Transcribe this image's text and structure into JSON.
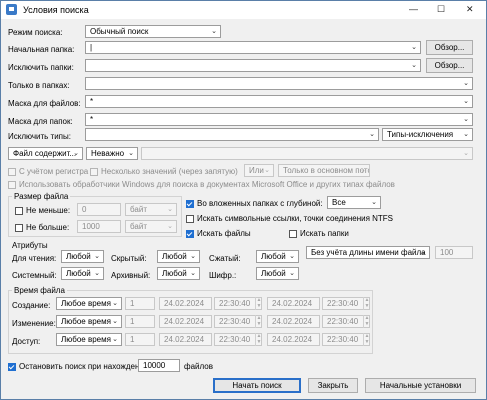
{
  "window": {
    "title": "Условия поиска",
    "minimize": "—",
    "maximize": "☐",
    "close": "✕"
  },
  "mode": {
    "label": "Режим поиска:",
    "value": "Обычный поиск"
  },
  "start_folder": {
    "label": "Начальная папка:",
    "value": "",
    "browse": "Обзор..."
  },
  "exclude_folders": {
    "label": "Исключить папки:",
    "value": "",
    "browse": "Обзор..."
  },
  "only_folders": {
    "label": "Только в папках:",
    "value": ""
  },
  "file_mask": {
    "label": "Маска для файлов:",
    "value": "*"
  },
  "folder_mask": {
    "label": "Маска для папок:",
    "value": "*"
  },
  "exclude_types": {
    "label": "Исключить типы:",
    "value": "",
    "type_select": "Типы-исключения"
  },
  "content": {
    "mode": "Файл содержит...",
    "match": "Неважно",
    "value": ""
  },
  "content_opts": {
    "case": "С учётом регистра",
    "multi": "Несколько значений (через запятую)",
    "or": "Или",
    "stream": "Только в основном потс",
    "office": "Использовать обработчики Windows для поиска в документах Microsoft Office и других типах файлов"
  },
  "size_group": {
    "title": "Размер файла",
    "not_less": "Не меньше:",
    "not_less_val": "0",
    "not_less_unit": "байт",
    "not_more": "Не больше:",
    "not_more_val": "1000",
    "not_more_unit": "байт"
  },
  "subfolders": {
    "label": "Во вложенных папках с глубиной:",
    "value": "Все",
    "checked": true
  },
  "symlinks": {
    "label": "Искать символьные ссылки, точки соединения NTFS",
    "checked": false
  },
  "search_files": {
    "label": "Искать файлы",
    "checked": true
  },
  "search_folders": {
    "label": "Искать папки",
    "checked": false
  },
  "attrs": {
    "title": "Атрибуты",
    "read": "Для чтения:",
    "read_val": "Любой",
    "hidden": "Скрытый:",
    "hidden_val": "Любой",
    "compressed": "Сжатый:",
    "compressed_val": "Любой",
    "system": "Системный:",
    "system_val": "Любой",
    "archive": "Архивный:",
    "archive_val": "Любой",
    "encrypted": "Шифр.:",
    "encrypted_val": "Любой"
  },
  "name_len": {
    "value": "Без учёта длины имени файла",
    "num": "100"
  },
  "time_group": {
    "title": "Время файла",
    "rows": [
      {
        "label": "Создание:",
        "mode": "Любое время",
        "n": "1",
        "d1": "24.02.2024",
        "t1": "22:30:40",
        "d2": "24.02.2024",
        "t2": "22:30:40"
      },
      {
        "label": "Изменение:",
        "mode": "Любое время",
        "n": "1",
        "d1": "24.02.2024",
        "t1": "22:30:40",
        "d2": "24.02.2024",
        "t2": "22:30:40"
      },
      {
        "label": "Доступ:",
        "mode": "Любое время",
        "n": "1",
        "d1": "24.02.2024",
        "t1": "22:30:40",
        "d2": "24.02.2024",
        "t2": "22:30:40"
      }
    ]
  },
  "stop": {
    "label": "Остановить поиск при нахождении",
    "value": "10000",
    "suffix": "файлов",
    "checked": true
  },
  "buttons": {
    "start": "Начать поиск",
    "close": "Закрыть",
    "reset": "Начальные установки"
  }
}
